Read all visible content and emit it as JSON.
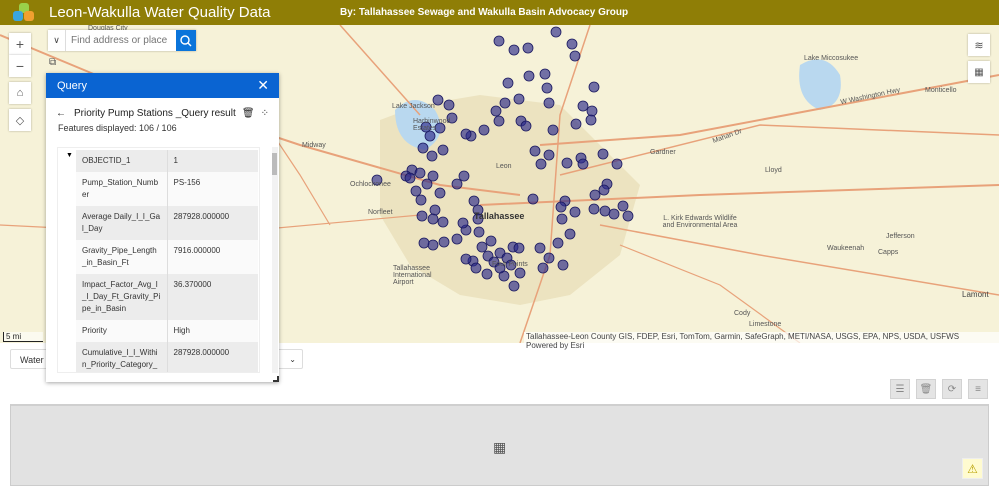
{
  "header": {
    "title": "Leon-Wakulla Water Quality Data",
    "subtitle": "By: Tallahassee Sewage and Wakulla Basin Advocacy Group"
  },
  "search": {
    "placeholder": "Find address or place"
  },
  "map": {
    "labels": [
      "Douglas City",
      "Lake Jackson",
      "Harbinwood Estates",
      "Midway",
      "Ochlockonee",
      "Norfleet",
      "Leon",
      "Tallahassee",
      "Tallahassee International Airport",
      "Four Points",
      "Gardner",
      "Lloyd",
      "L. Kirk Edwards Wildlife and Environmental Area",
      "Waukeenah",
      "Capps",
      "Jefferson",
      "Monticello",
      "Lake Miccosukee",
      "Cody",
      "Limestone",
      "Lamont",
      "W Washington Hwy",
      "Mahan Dr"
    ],
    "scale": "5 mi",
    "attribution": "Tallahassee-Leon County GIS, FDEP, Esri, TomTom, Garmin, SafeGraph, METI/NASA, USGS, EPA, NPS, USDA, USFWS",
    "powered_by": "Powered by Esri",
    "point_color": "#2b2a8a"
  },
  "query": {
    "header": "Query",
    "result_title": "Priority Pump Stations _Query result",
    "features": "Features displayed: 106 / 106",
    "rows": [
      {
        "k": "OBJECTID_1",
        "v": "1"
      },
      {
        "k": "Pump_Station_Number",
        "v": "PS-156"
      },
      {
        "k": "Average Daily_I_I_Gal_Day",
        "v": "287928.000000"
      },
      {
        "k": "Gravity_Pipe_Length_in_Basin_Ft",
        "v": "7916.000000"
      },
      {
        "k": "Impact_Factor_Avg_I_I_Day_Ft_Gravity_Pipe_in_Basin",
        "v": "36.370000"
      },
      {
        "k": "Priority",
        "v": "High"
      },
      {
        "k": "Cumulative_I_I_Within_Priority_Category_Gal_Day",
        "v": "287928.000000"
      }
    ]
  },
  "table_select": {
    "value": "Water Q"
  }
}
